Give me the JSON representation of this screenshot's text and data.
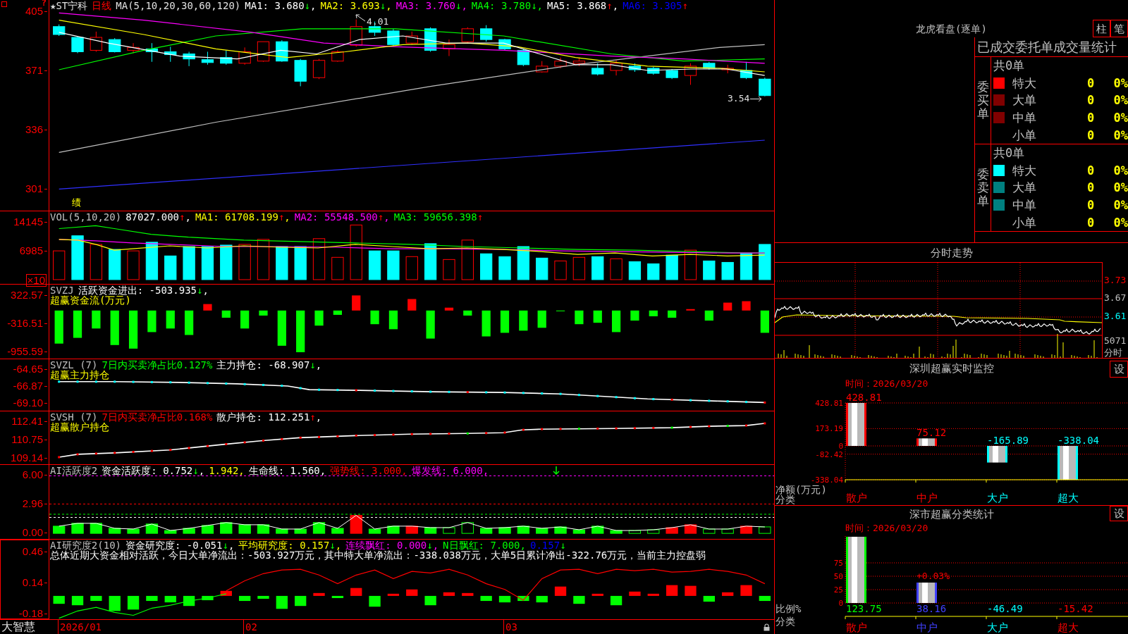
{
  "panels": [
    {
      "kind": "candles",
      "selected": false,
      "lines": [
        [
          {
            "text": "★ST宁科",
            "color": "#e0e0e0"
          },
          {
            "text": "日线",
            "color": "#ff0000"
          },
          {
            "text": "MA(5,10,20,30,60,120)",
            "color": "#e0e0e0"
          },
          {
            "text": "MA1: 3.680",
            "color": "#ffffff",
            "arrow": "↓",
            "rising": false,
            "tail": ","
          },
          {
            "text": "MA2: 3.693",
            "color": "#ffff00",
            "arrow": "↓",
            "rising": false,
            "tail": ","
          },
          {
            "text": "MA3: 3.760",
            "color": "#ff00ff",
            "arrow": "↓",
            "rising": false,
            "tail": ","
          },
          {
            "text": "MA4: 3.780",
            "color": "#00ff00",
            "arrow": "↓",
            "rising": false,
            "tail": ","
          },
          {
            "text": "MA5: 3.868",
            "color": "#ffffff",
            "arrow": "↑",
            "rising": true,
            "tail": ","
          },
          {
            "text": "MA6: 3.305",
            "color": "#0000ff",
            "arrow": "↑",
            "rising": true
          }
        ]
      ],
      "help_mark": "?",
      "y_labels": [
        "405",
        "371",
        "336",
        "301"
      ],
      "annotations": [
        {
          "kind": "high",
          "text": "4.01"
        },
        {
          "kind": "low",
          "text": "3.54"
        }
      ],
      "event_marker": "绩"
    },
    {
      "kind": "volume",
      "selected": false,
      "lines": [
        [
          {
            "text": "VOL(5,10,20)"
          },
          {
            "text": "87027.000",
            "color": "#ffffff",
            "arrow": "↑",
            "rising": true,
            "tail": ","
          },
          {
            "text": "MA1: 61708.199",
            "color": "#ffff00",
            "arrow": "↑",
            "rising": true,
            "tail": ","
          },
          {
            "text": "MA2: 55548.500",
            "color": "#ff00ff",
            "arrow": "↑",
            "rising": true,
            "tail": ","
          },
          {
            "text": "MA3: 59656.398",
            "color": "#00ff00",
            "arrow": "↑",
            "rising": true
          }
        ]
      ],
      "y_labels": [
        "14145",
        "6985"
      ],
      "unit_badge": "×10"
    },
    {
      "kind": "flow",
      "selected": false,
      "lines": [
        [
          {
            "text": "SVZJ"
          },
          {
            "text": "活跃资金进出: -503.935",
            "color": "#ffffff",
            "arrow": "↓",
            "rising": false,
            "tail": ","
          }
        ],
        [
          {
            "text": "超赢资金流(万元)",
            "color": "#ffff00"
          }
        ]
      ],
      "y_labels": [
        "322.57",
        "-316.51",
        "-955.59"
      ]
    },
    {
      "kind": "institutional",
      "selected": false,
      "lines": [
        [
          {
            "text": "SVZL (7)"
          },
          {
            "text": "7日内买卖净占比0.127%",
            "color": "#00ff00"
          },
          {
            "text": "主力持仓: -68.907",
            "color": "#ffffff",
            "arrow": "↓",
            "rising": false,
            "tail": ","
          }
        ],
        [
          {
            "text": "超赢主力持仓",
            "color": "#ffff00"
          }
        ]
      ],
      "y_labels": [
        "-64.65",
        "-66.87",
        "-69.10"
      ]
    },
    {
      "kind": "retail",
      "selected": false,
      "lines": [
        [
          {
            "text": "SVSH (7)"
          },
          {
            "text": "7日内买卖净占比0.168%",
            "color": "#ff0000"
          },
          {
            "text": "散户持仓: 112.251",
            "color": "#ffffff",
            "arrow": "↑",
            "rising": true,
            "tail": ","
          }
        ],
        [
          {
            "text": "超赢散户持仓",
            "color": "#ffff00"
          }
        ]
      ],
      "y_labels": [
        "112.41",
        "110.75",
        "109.14"
      ]
    },
    {
      "kind": "activity",
      "selected": false,
      "lines": [
        [
          {
            "text": "AI活跃度2"
          },
          {
            "text": "资金活跃度: 0.752",
            "color": "#ffffff",
            "arrow": "↓",
            "rising": false,
            "tail": ","
          },
          {
            "text": "1.942,",
            "color": "#ffff00"
          },
          {
            "text": "生命线: 1.560,",
            "color": "#ffffff"
          },
          {
            "text": "强势线: 3.000,",
            "color": "#ff0000"
          },
          {
            "text": "爆发线: 6.000,",
            "color": "#ff00ff"
          }
        ]
      ],
      "y_labels": [
        "6.00",
        "2.96",
        "0.00"
      ]
    },
    {
      "kind": "research",
      "selected": true,
      "lines": [
        [
          {
            "text": "AI研究度2(10)"
          },
          {
            "text": "资金研究度: -0.051",
            "color": "#ffffff",
            "arrow": "↓",
            "rising": false,
            "tail": ","
          },
          {
            "text": "平均研究度: 0.157",
            "color": "#ffff00",
            "arrow": "↓",
            "rising": false,
            "tail": ","
          },
          {
            "text": "连续飘红: 0.000",
            "color": "#ff00ff",
            "arrow": "↓",
            "rising": false,
            "tail": ","
          },
          {
            "text": "N日飘红: 7.000,",
            "color": "#00ff00"
          },
          {
            "text": "0.157",
            "color": "#0000ff",
            "arrow": "↓",
            "rising": false
          }
        ],
        [
          {
            "text": "总体近期大资金相对活跃，今日大单净流出：-503.927万元，其中特大单净流出：-338.038万元，大单5日累计净出-322.76万元，当前主力控盘弱",
            "color": "#ffffff"
          }
        ]
      ],
      "y_labels": [
        "0.46",
        "0.14",
        "-0.18"
      ]
    }
  ],
  "date_axis": {
    "brand": "大智慧",
    "dates": [
      "2026/01",
      "02",
      "03"
    ]
  },
  "order_monitor": {
    "title": "龙虎看盘(逐单)",
    "buttons": [
      {
        "label": "柱"
      },
      {
        "label": "笔"
      }
    ],
    "table_title": "已成交委托单成交量统计",
    "sections": [
      {
        "label": "委买单",
        "total": "共0单",
        "rows": [
          {
            "name": "特大",
            "color": "#ff0000",
            "count": "0",
            "share": "0%"
          },
          {
            "name": "大单",
            "color": "#800000",
            "count": "0",
            "share": "0%"
          },
          {
            "name": "中单",
            "color": "#800000",
            "count": "0",
            "share": "0%"
          },
          {
            "name": "小单",
            "count": "0",
            "share": "0%"
          }
        ]
      },
      {
        "label": "委卖单",
        "total": "共0单",
        "rows": [
          {
            "name": "特大",
            "color": "#00ffff",
            "count": "0",
            "share": "0%"
          },
          {
            "name": "大单",
            "color": "#008080",
            "count": "0",
            "share": "0%"
          },
          {
            "name": "中单",
            "color": "#008080",
            "count": "0",
            "share": "0%"
          },
          {
            "name": "小单",
            "count": "0",
            "share": "0%"
          }
        ]
      }
    ]
  },
  "intraday": {
    "title": "分时走势",
    "price_labels": [
      {
        "text": "3.73",
        "color": "#ff0000"
      },
      {
        "text": "3.67",
        "color": "#c0c0c0"
      },
      {
        "text": "3.61",
        "color": "#00ffff"
      }
    ],
    "volume_label": "5071",
    "axis_label": "分时"
  },
  "sz_monitor": {
    "title": "深圳超赢实时监控",
    "settings": "设",
    "time": "时间：2026/03/20",
    "bars": [
      {
        "color": "#ff0000"
      },
      {
        "color": "#ff0000"
      },
      {
        "color": "#00ffff"
      },
      {
        "color": "#00ffff"
      }
    ],
    "category_labels": [
      {
        "color": "#ff0000"
      },
      {
        "color": "#ff0000"
      },
      {
        "color": "#00ffff"
      },
      {
        "color": "#00ffff"
      }
    ],
    "chart_data": {
      "type": "bar",
      "xlabel": "分类",
      "ylabel": "净额(万元)",
      "categories": [
        "散户",
        "中户",
        "大户",
        "超大"
      ],
      "values": [
        428.81,
        75.12,
        -165.89,
        -338.04
      ],
      "ylim": [
        -338.04,
        428.81
      ],
      "yticks": [
        428.81,
        173.19,
        0,
        -82.42,
        -338.04
      ],
      "grid": true,
      "data_labels": true
    }
  },
  "sh_stats": {
    "title": "深市超赢分类统计",
    "settings": "设",
    "time": "时间：2026/03/20",
    "bars": [
      {
        "color": "#00ff00"
      },
      {
        "color": "#4040ff",
        "note": "+0.03%"
      },
      {
        "color": "#00ffff"
      },
      {
        "color": "#ff0000"
      }
    ],
    "category_labels": [
      {
        "color": "#ff0000"
      },
      {
        "color": "#4040ff"
      },
      {
        "color": "#00ffff"
      },
      {
        "color": "#ff0000"
      }
    ],
    "chart_data": {
      "type": "bar",
      "xlabel": "分类",
      "ylabel": "比例%",
      "categories": [
        "散户",
        "中户",
        "大户",
        "超大"
      ],
      "values": [
        123.75,
        38.16,
        null,
        null
      ],
      "value_labels": [
        "123.75",
        "38.16",
        "-46.49",
        "-15.42"
      ],
      "ylim": [
        0,
        125
      ],
      "yticks": [
        75,
        50,
        25,
        0
      ],
      "grid": true
    }
  }
}
